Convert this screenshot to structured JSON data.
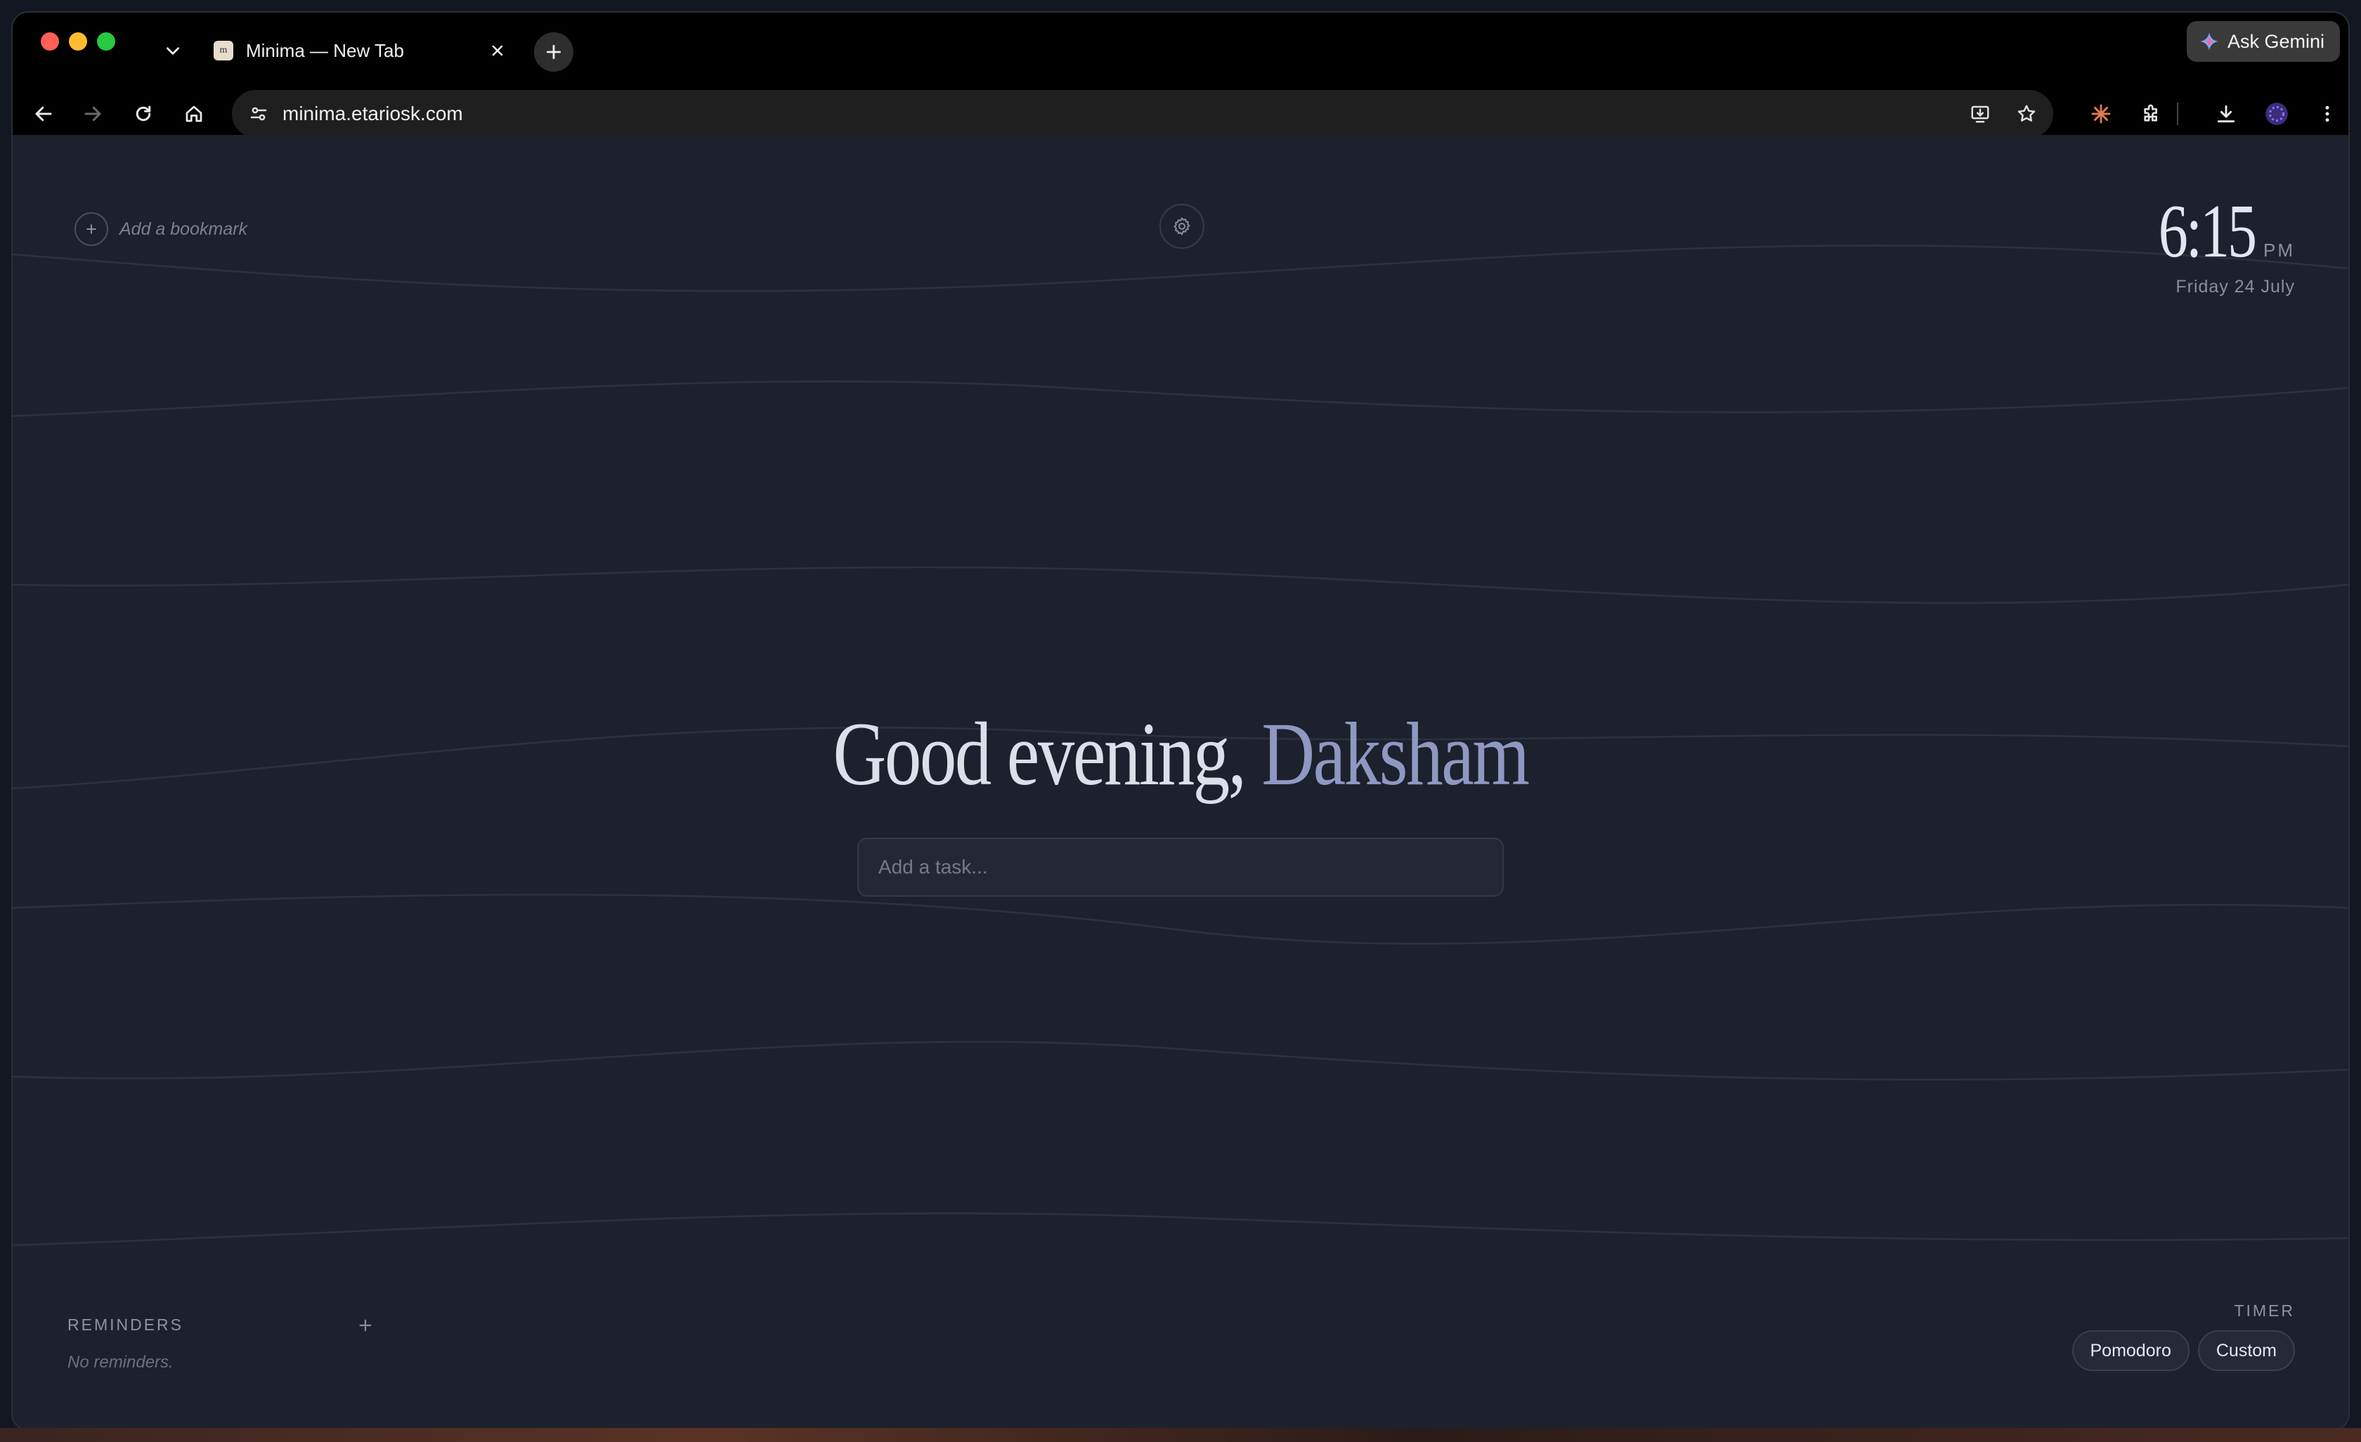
{
  "browser": {
    "tab": {
      "title": "Minima — New Tab",
      "favicon_text": "m"
    },
    "gemini_button": {
      "label": "Ask Gemini"
    },
    "omnibox": {
      "url": "minima.etariosk.com"
    }
  },
  "page": {
    "bookmark": {
      "add_label": "Add a bookmark"
    },
    "clock": {
      "time": "6:15",
      "ampm": "PM",
      "date": "Friday 24 July"
    },
    "greeting": {
      "prefix": "Good evening,",
      "name": "Daksham"
    },
    "task_input": {
      "placeholder": "Add a task..."
    },
    "reminders": {
      "title": "REMINDERS",
      "empty_text": "No reminders."
    },
    "timer": {
      "title": "TIMER",
      "buttons": [
        "Pomodoro",
        "Custom"
      ]
    }
  },
  "colors": {
    "page_background": "#1d212d",
    "greeting_accent": "#8f98c2",
    "browser_chrome": "#000000"
  }
}
